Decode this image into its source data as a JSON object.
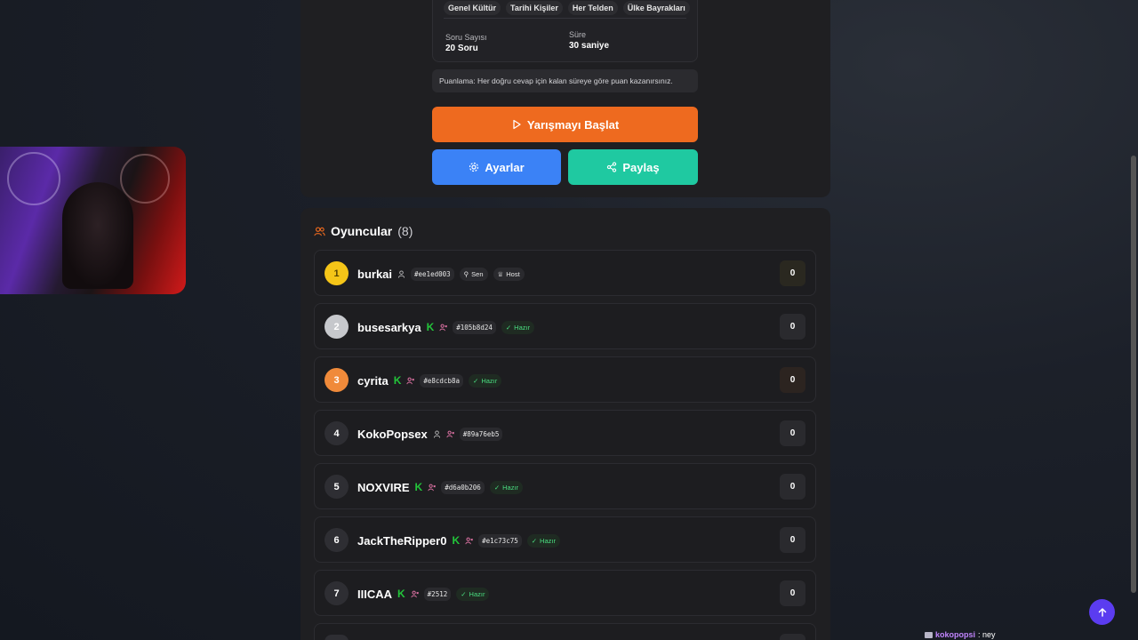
{
  "info": {
    "tags": [
      "Genel Kültür",
      "Tarihi Kişiler",
      "Her Telden",
      "Ülke Bayrakları"
    ],
    "question_count_label": "Soru Sayısı",
    "question_count_value": "20 Soru",
    "time_label": "Süre",
    "time_value": "30 saniye",
    "scoring_text": "Puanlama: Her doğru cevap için kalan süreye göre puan kazanırsınız."
  },
  "buttons": {
    "start": "Yarışmayı Başlat",
    "settings": "Ayarlar",
    "share": "Paylaş"
  },
  "players": {
    "title": "Oyuncular",
    "count": "(8)",
    "list": [
      {
        "rank": "1",
        "name": "burkai",
        "hash": "#ee1ed003",
        "you": "Sen",
        "host": "Host",
        "score": "0"
      },
      {
        "rank": "2",
        "name": "busesarkya",
        "kick": "K",
        "hash": "#105b8d24",
        "status": "Hazır",
        "score": "0"
      },
      {
        "rank": "3",
        "name": "cyrita",
        "kick": "K",
        "hash": "#e8cdcb8a",
        "status": "Hazır",
        "score": "0"
      },
      {
        "rank": "4",
        "name": "KokoPopsex",
        "hash": "#89a76eb5",
        "score": "0"
      },
      {
        "rank": "5",
        "name": "NOXVIRE",
        "kick": "K",
        "hash": "#d6a0b206",
        "status": "Hazır",
        "score": "0"
      },
      {
        "rank": "6",
        "name": "JackTheRipper0",
        "kick": "K",
        "hash": "#e1c73c75",
        "status": "Hazır",
        "score": "0"
      },
      {
        "rank": "7",
        "name": "IIICAA",
        "kick": "K",
        "hash": "#2512",
        "status": "Hazır",
        "score": "0"
      }
    ]
  },
  "chat": {
    "user": "kokopopsi",
    "message": ": ney"
  },
  "colors": {
    "accent_orange": "#ee6a1f",
    "accent_blue": "#3b82f6",
    "accent_teal": "#1fc9a1",
    "kick_green": "#23c43a",
    "ready_green": "#4ade80",
    "rank_gold": "#f5c518",
    "rank_silver": "#c6c8cc",
    "rank_bronze": "#f08a3a"
  }
}
